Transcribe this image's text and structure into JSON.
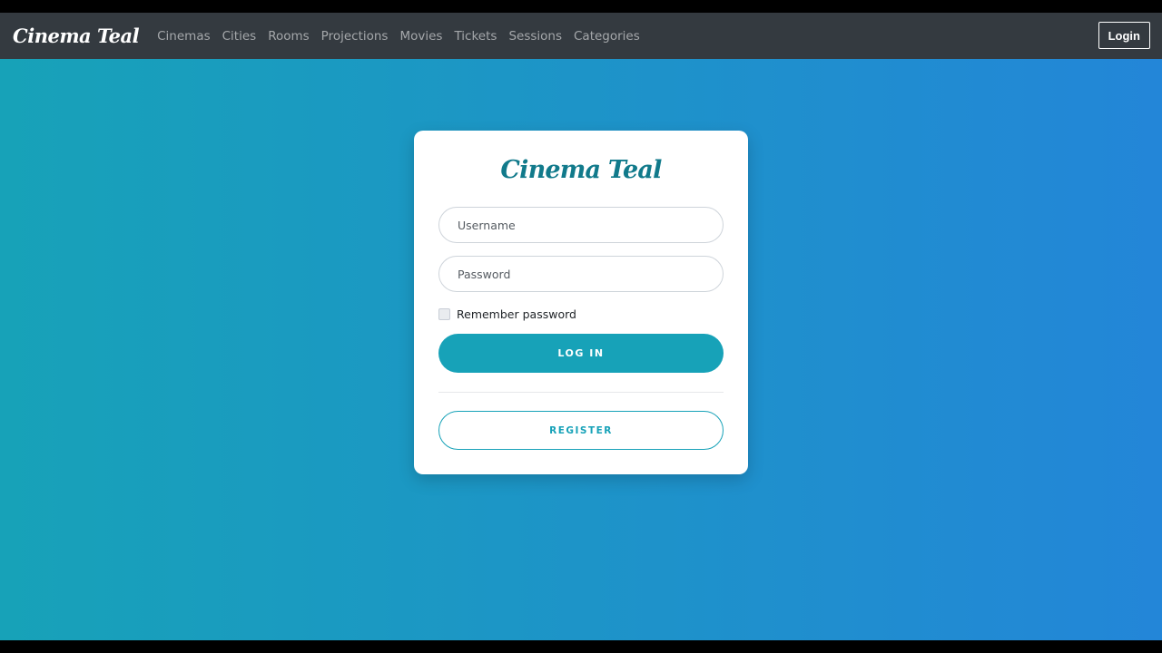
{
  "navbar": {
    "brand": "Cinema Teal",
    "links": [
      {
        "label": "Cinemas"
      },
      {
        "label": "Cities"
      },
      {
        "label": "Rooms"
      },
      {
        "label": "Projections"
      },
      {
        "label": "Movies"
      },
      {
        "label": "Tickets"
      },
      {
        "label": "Sessions"
      },
      {
        "label": "Categories"
      }
    ],
    "login_label": "Login"
  },
  "login_card": {
    "title": "Cinema Teal",
    "username_placeholder": "Username",
    "password_placeholder": "Password",
    "remember_label": "Remember password",
    "remember_checked": false,
    "login_button": "LOG IN",
    "register_button": "REGISTER"
  },
  "colors": {
    "navbar_bg": "#343a40",
    "accent": "#17a2b8",
    "gradient_start": "#17a2b8",
    "gradient_end": "#2386d8",
    "title": "#117a8b"
  }
}
